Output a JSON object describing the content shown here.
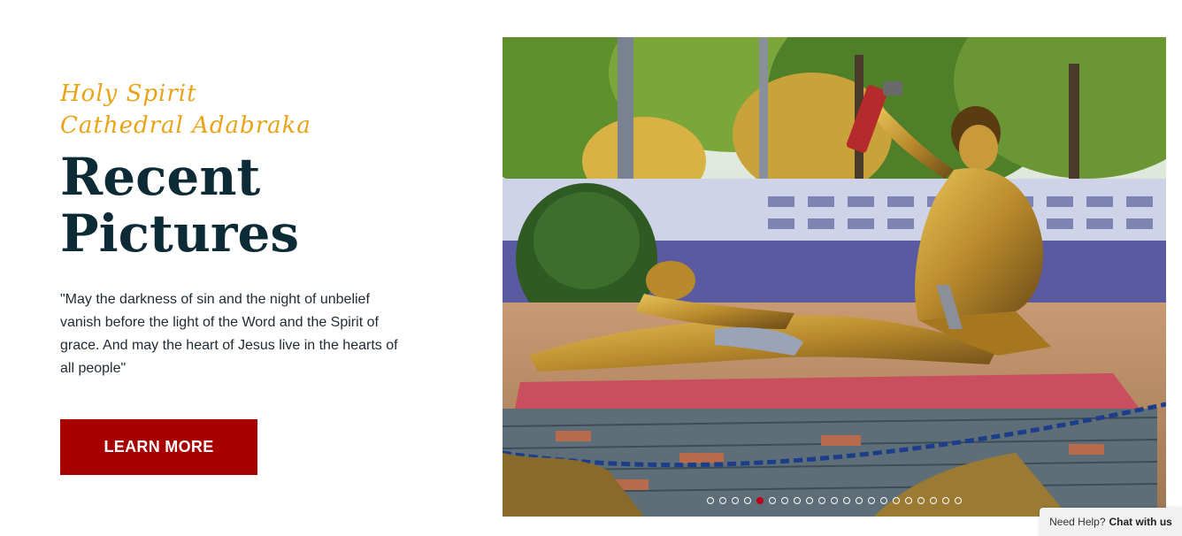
{
  "hero": {
    "subtitle": "Holy Spirit Cathedral Adabraka",
    "title": "Recent Pictures",
    "quote": "\"May the darkness of sin and the night of unbelief vanish before the light of the Word and the Spirit of grace. And may the heart of Jesus live in the hearts of all people\"",
    "cta_label": "LEARN MORE"
  },
  "slider": {
    "image_alt": "Bronze sculpture of the crucifixion in the cathedral garden",
    "slide_count": 21,
    "active_index": 4
  },
  "chat": {
    "prefix": "Need Help?",
    "label": "Chat with us"
  },
  "colors": {
    "accent_script": "#e8a317",
    "heading": "#0c2b36",
    "button": "#a80000",
    "active_dot": "#c0001a"
  }
}
